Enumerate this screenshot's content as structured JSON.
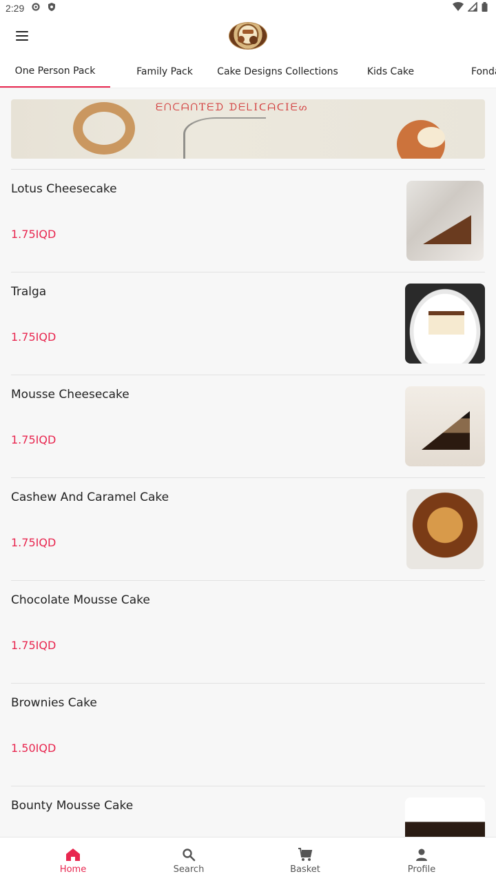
{
  "status_bar": {
    "time": "2:29",
    "icons": [
      "gear-icon",
      "shield-icon",
      "wifi-icon",
      "signal-icon",
      "battery-icon"
    ]
  },
  "app_bar": {
    "menu_icon": "hamburger-menu-icon",
    "logo": "bakery-logo"
  },
  "tabs": [
    {
      "label": "One Person Pack",
      "active": true
    },
    {
      "label": "Family Pack",
      "active": false
    },
    {
      "label": "Cake Designs Collections",
      "active": false
    },
    {
      "label": "Kids Cake",
      "active": false
    },
    {
      "label": "Fondar",
      "active": false
    }
  ],
  "banner": {
    "text": "ᗴᑎᑕᗩᑎTᗴᗪ ᗪᗴᒪIᑕᗩᑕIᗴᔕ"
  },
  "items": [
    {
      "name": "Lotus Cheesecake",
      "price": "1.75IQD",
      "has_image": true
    },
    {
      "name": "Tralga",
      "price": "1.75IQD",
      "has_image": true
    },
    {
      "name": "Mousse Cheesecake",
      "price": "1.75IQD",
      "has_image": true
    },
    {
      "name": "Cashew And Caramel Cake",
      "price": "1.75IQD",
      "has_image": true
    },
    {
      "name": "Chocolate Mousse Cake",
      "price": "1.75IQD",
      "has_image": false
    },
    {
      "name": "Brownies Cake",
      "price": "1.50IQD",
      "has_image": false
    },
    {
      "name": "Bounty Mousse Cake",
      "price": "",
      "has_image": true
    }
  ],
  "bottom_nav": [
    {
      "label": "Home",
      "icon": "home-icon",
      "active": true
    },
    {
      "label": "Search",
      "icon": "search-icon",
      "active": false
    },
    {
      "label": "Basket",
      "icon": "cart-icon",
      "active": false
    },
    {
      "label": "Profile",
      "icon": "profile-icon",
      "active": false
    }
  ],
  "colors": {
    "accent": "#e8264f",
    "background": "#f7f7f7",
    "surface": "#ffffff"
  }
}
